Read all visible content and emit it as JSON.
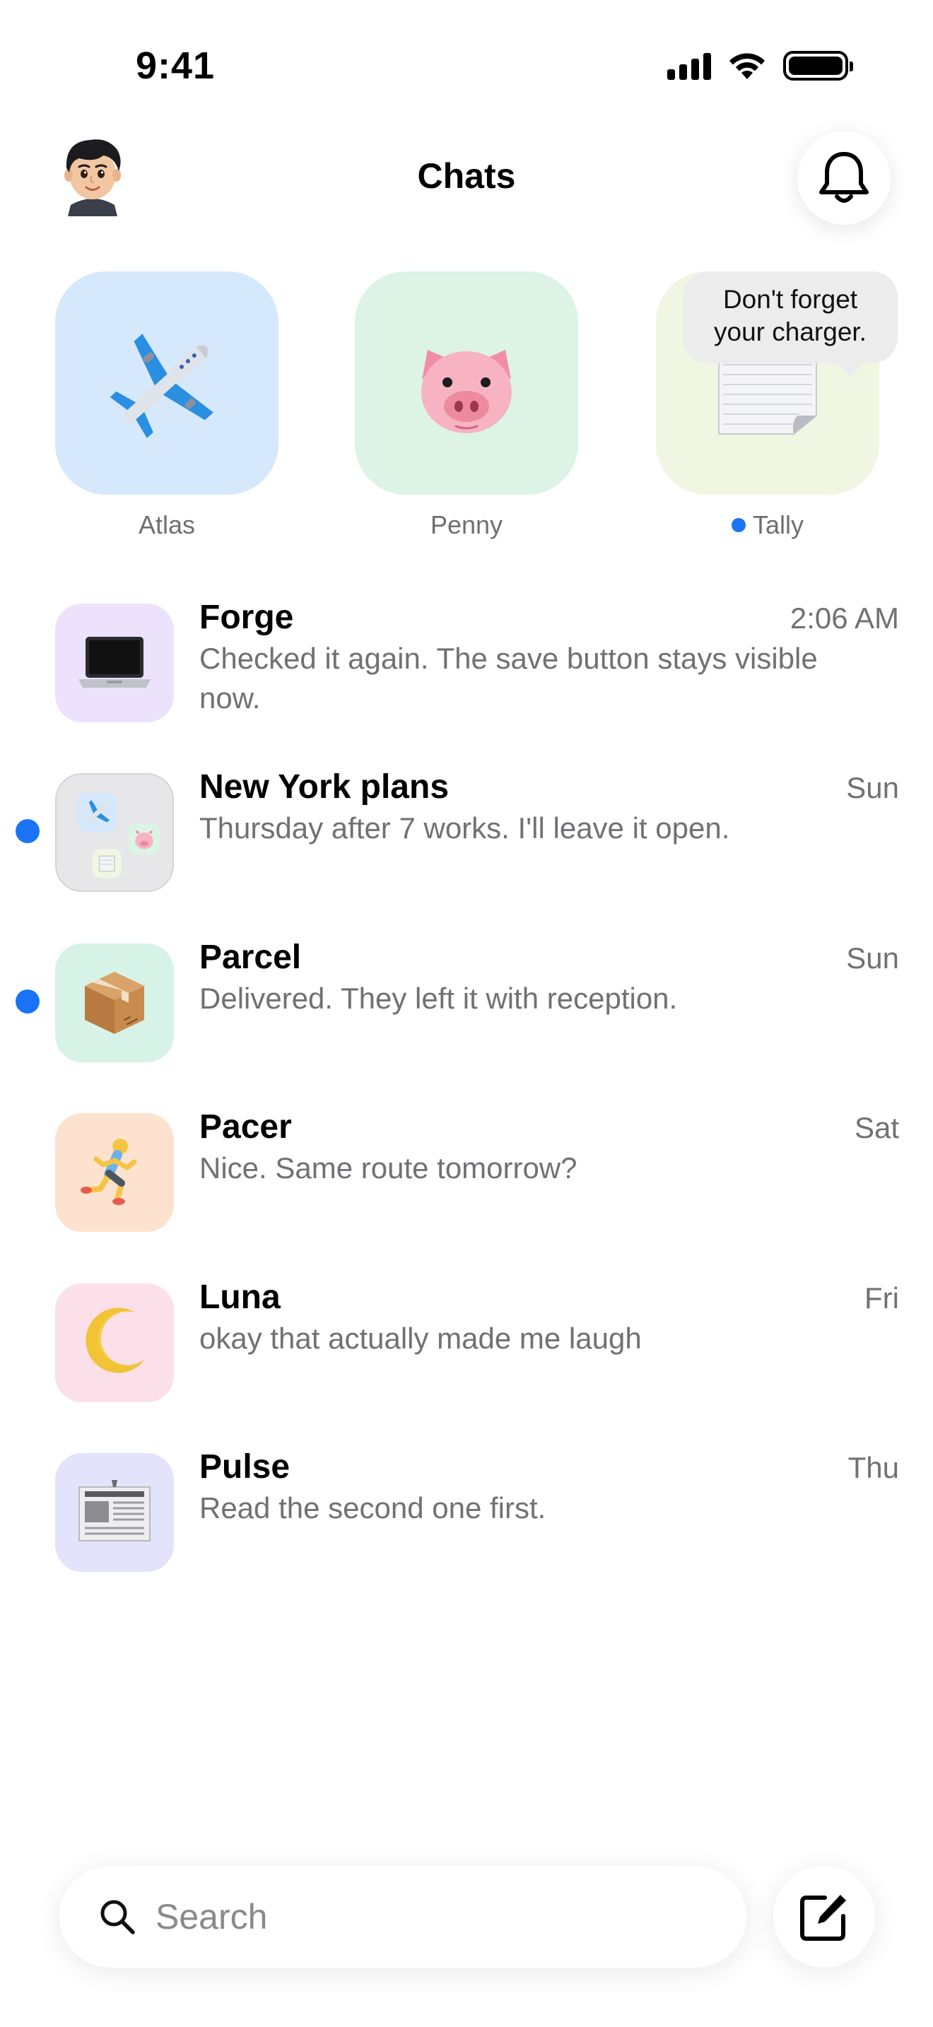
{
  "status_bar": {
    "time": "9:41",
    "icons": [
      "cellular-signal-icon",
      "wifi-icon",
      "battery-icon"
    ]
  },
  "header": {
    "title": "Chats",
    "profile_avatar_icon": "memoji-boy-icon",
    "notification_icon": "bell-icon"
  },
  "pinned": [
    {
      "label": "Atlas",
      "icon": "airplane-icon",
      "bg": "#d6e8fb",
      "unread": false
    },
    {
      "label": "Penny",
      "icon": "pig-face-icon",
      "bg": "#dcf3e6",
      "unread": false
    },
    {
      "label": "Tally",
      "icon": "page-curl-icon",
      "bg": "#f0f6e2",
      "unread": true
    }
  ],
  "tooltip": {
    "line1": "Don't forget",
    "line2": "your charger."
  },
  "chats": [
    {
      "name": "Forge",
      "time": "2:06 AM",
      "preview": "Checked it again. The save button stays visible now.",
      "icon": "laptop-icon",
      "bg": "#ede2fb",
      "unread": false
    },
    {
      "name": "New York plans",
      "time": "Sun",
      "preview": "Thursday after 7 works. I'll leave it open.",
      "icon": "group-avatar-icon",
      "bg": "#e7e7ea",
      "unread": true
    },
    {
      "name": "Parcel",
      "time": "Sun",
      "preview": "Delivered. They left it with reception.",
      "icon": "package-icon",
      "bg": "#d7f2e6",
      "unread": true
    },
    {
      "name": "Pacer",
      "time": "Sat",
      "preview": "Nice. Same route tomorrow?",
      "icon": "runner-icon",
      "bg": "#fde3cf",
      "unread": false
    },
    {
      "name": "Luna",
      "time": "Fri",
      "preview": "okay that actually made me laugh",
      "icon": "crescent-moon-icon",
      "bg": "#fbe0ea",
      "unread": false
    },
    {
      "name": "Pulse",
      "time": "Thu",
      "preview": "Read the second one first.",
      "icon": "newspaper-icon",
      "bg": "#e3e4fb",
      "unread": false
    }
  ],
  "bottom": {
    "search_placeholder": "Search",
    "search_icon": "magnifier-icon",
    "compose_icon": "compose-icon"
  },
  "colors": {
    "unread_dot": "#1a73f5",
    "secondary_text": "#707075"
  }
}
